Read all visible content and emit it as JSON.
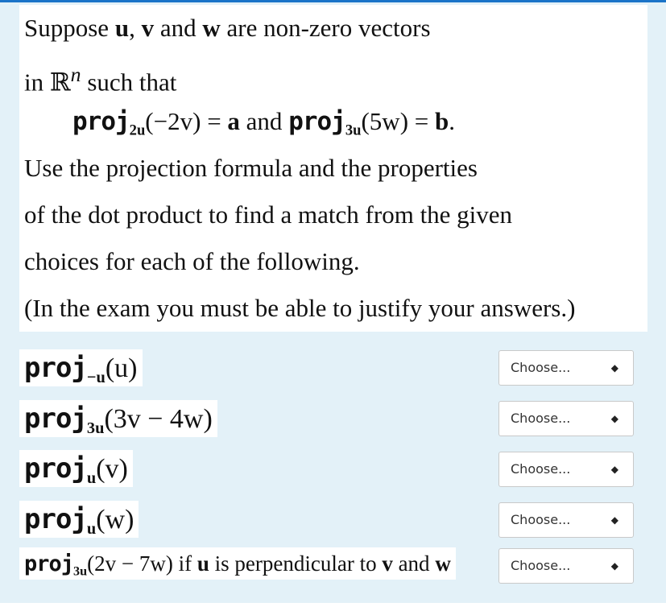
{
  "intro": {
    "line1_pre": "Suppose ",
    "u": "u",
    "sep1": ", ",
    "v": "v",
    "and": " and ",
    "w": "w",
    "line1_post": " are non-zero vectors",
    "line2_pre": "in ",
    "rn": "ℝ",
    "n": "n",
    "line2_post": " such that",
    "eq": {
      "proj": "proj",
      "sub1": "2u",
      "arg1": "(−2v)",
      "eq1": " = ",
      "a": "a",
      "and": "  and  ",
      "sub2": "3u",
      "arg2": "(5w)",
      "eq2": " = ",
      "b": "b",
      "end": "."
    },
    "line4": "Use the projection formula and the properties",
    "line5": "of the dot product to find a match from the given",
    "line6": "choices for each of the following.",
    "line7": "(In the exam you must be able to justify your answers.)"
  },
  "questions": [
    {
      "proj": "proj",
      "sub": "−u",
      "arg": "(u)",
      "choice": "Choose..."
    },
    {
      "proj": "proj",
      "sub": "3u",
      "arg": "(3v − 4w)",
      "choice": "Choose..."
    },
    {
      "proj": "proj",
      "sub": "u",
      "arg": "(v)",
      "choice": "Choose..."
    },
    {
      "proj": "proj",
      "sub": "u",
      "arg": "(w)",
      "choice": "Choose..."
    },
    {
      "proj": "proj",
      "sub": "3u",
      "arg": "(2v − 7w)",
      "cond1": "  if ",
      "u": "u",
      "cond2": "  is perpendicular to ",
      "v": "v",
      "cond3": "  and  ",
      "w": "w",
      "choice": "Choose..."
    }
  ]
}
